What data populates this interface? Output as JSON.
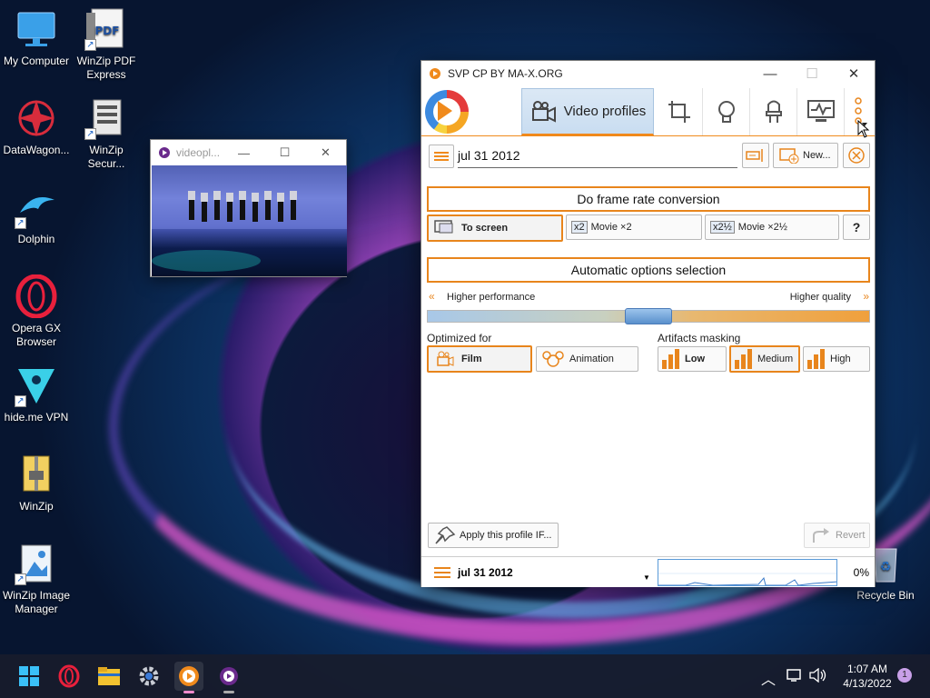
{
  "desktop": {
    "icons": [
      {
        "label": "My Computer"
      },
      {
        "label": "WinZip PDF Express"
      },
      {
        "label": "DataWagon..."
      },
      {
        "label": "WinZip Secur..."
      },
      {
        "label": "Dolphin"
      },
      {
        "label": "Opera GX Browser"
      },
      {
        "label": "hide.me VPN"
      },
      {
        "label": "WinZip"
      },
      {
        "label": "WinZip Image Manager"
      },
      {
        "label": "Recycle Bin"
      }
    ],
    "pdf_icon_text": "PDF"
  },
  "video_window": {
    "title": "videopl...",
    "minimize": "—",
    "maximize": "☐",
    "close": "✕"
  },
  "svp": {
    "title": "SVP CP BY MA-X.ORG",
    "minimize": "—",
    "maximize": "☐",
    "close": "✕",
    "active_tab": "Video profiles",
    "profile_name": "jul 31 2012",
    "new_button": "New...",
    "frame_rate_button": "Do frame rate conversion",
    "to_screen": "To screen",
    "movie_x2": "Movie ×2",
    "movie_x2_icon": "x2",
    "movie_x25": "Movie ×2½",
    "movie_x25_icon": "x2½",
    "help": "?",
    "auto_options": "Automatic options selection",
    "higher_performance": "Higher performance",
    "higher_quality": "Higher quality",
    "slider_level": 0.5,
    "optimized_for": "Optimized for",
    "film": "Film",
    "animation": "Animation",
    "artifacts_masking": "Artifacts masking",
    "low": "Low",
    "medium": "Medium",
    "high": "High",
    "apply_profile": "Apply this profile IF...",
    "revert": "Revert",
    "footer_profile": "jul 31 2012",
    "cpu_percent": "0%"
  },
  "taskbar": {
    "time": "1:07 AM",
    "date": "4/13/2022",
    "notification_count": "1"
  },
  "colors": {
    "accent": "#e8851c",
    "selection_blue": "#c9ddf1",
    "taskbar": "#181c2c"
  }
}
